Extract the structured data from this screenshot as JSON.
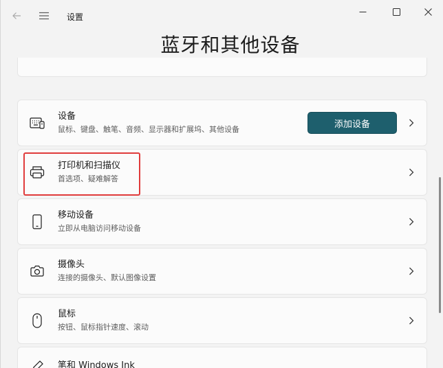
{
  "window": {
    "app_title": "设置",
    "controls": {
      "minimize": "—",
      "maximize": "☐",
      "close": "✕"
    }
  },
  "page": {
    "title": "蓝牙和其他设备"
  },
  "items": [
    {
      "title": "设备",
      "subtitle": "鼠标、键盘、触笔、音频、显示器和扩展坞、其他设备",
      "icon": "keyboard-icon",
      "action_label": "添加设备"
    },
    {
      "title": "打印机和扫描仪",
      "subtitle": "首选项、疑难解答",
      "icon": "printer-icon"
    },
    {
      "title": "移动设备",
      "subtitle": "立即从电脑访问移动设备",
      "icon": "phone-icon"
    },
    {
      "title": "摄像头",
      "subtitle": "连接的摄像头、默认图像设置",
      "icon": "camera-icon"
    },
    {
      "title": "鼠标",
      "subtitle": "按钮、鼠标指针速度、滚动",
      "icon": "mouse-icon"
    },
    {
      "title": "笔和 Windows Ink",
      "subtitle": "",
      "icon": "pen-icon"
    }
  ],
  "colors": {
    "accent": "#1e5f6d",
    "highlight": "#e03a3a",
    "background": "#f3f3f3",
    "card": "#fbfbfb"
  }
}
